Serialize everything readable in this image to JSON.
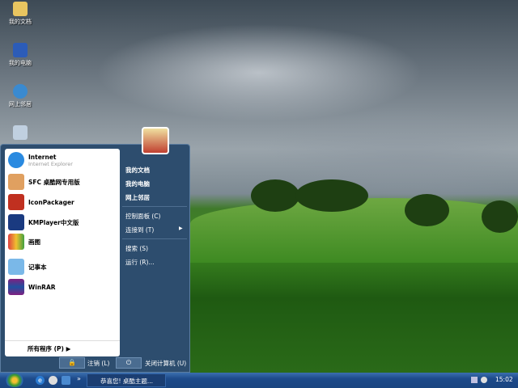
{
  "desktop": {
    "icons": [
      {
        "label": "我的文档",
        "icon": "folder-icon"
      },
      {
        "label": "我的电脑",
        "icon": "computer-icon"
      },
      {
        "label": "网上邻居",
        "icon": "network-icon"
      },
      {
        "label": "",
        "icon": "recycle-bin-icon"
      }
    ]
  },
  "start_menu": {
    "pinned": [
      {
        "label": "Internet",
        "sub": "Internet Explorer",
        "icon": "internet-explorer-icon"
      },
      {
        "label": "SFC 桌酷网专用版",
        "icon": "sfc-icon"
      },
      {
        "label": "IconPackager",
        "icon": "iconpackager-icon"
      },
      {
        "label": "KMPlayer中文版",
        "icon": "kmplayer-icon"
      },
      {
        "label": "画图",
        "icon": "paint-icon"
      },
      {
        "label": "记事本",
        "icon": "notepad-icon"
      },
      {
        "label": "WinRAR",
        "icon": "winrar-icon"
      }
    ],
    "all_programs": "所有程序 (P)",
    "right": [
      {
        "label": "我的文档"
      },
      {
        "label": "我的电脑"
      },
      {
        "label": "网上邻居"
      },
      {
        "label": "控制面板 (C)"
      },
      {
        "label": "连接到 (T)"
      },
      {
        "label": "搜索 (S)"
      },
      {
        "label": "运行 (R)..."
      }
    ],
    "logoff": "注销 (L)",
    "shutdown": "关闭计算机 (U)"
  },
  "taskbar": {
    "task": "恭喜您! 桌酷主题...",
    "more": "»",
    "clock": "15:02"
  },
  "colors": {
    "taskbar": "#1d4a8a",
    "menu_right": "#2d4d6e"
  }
}
